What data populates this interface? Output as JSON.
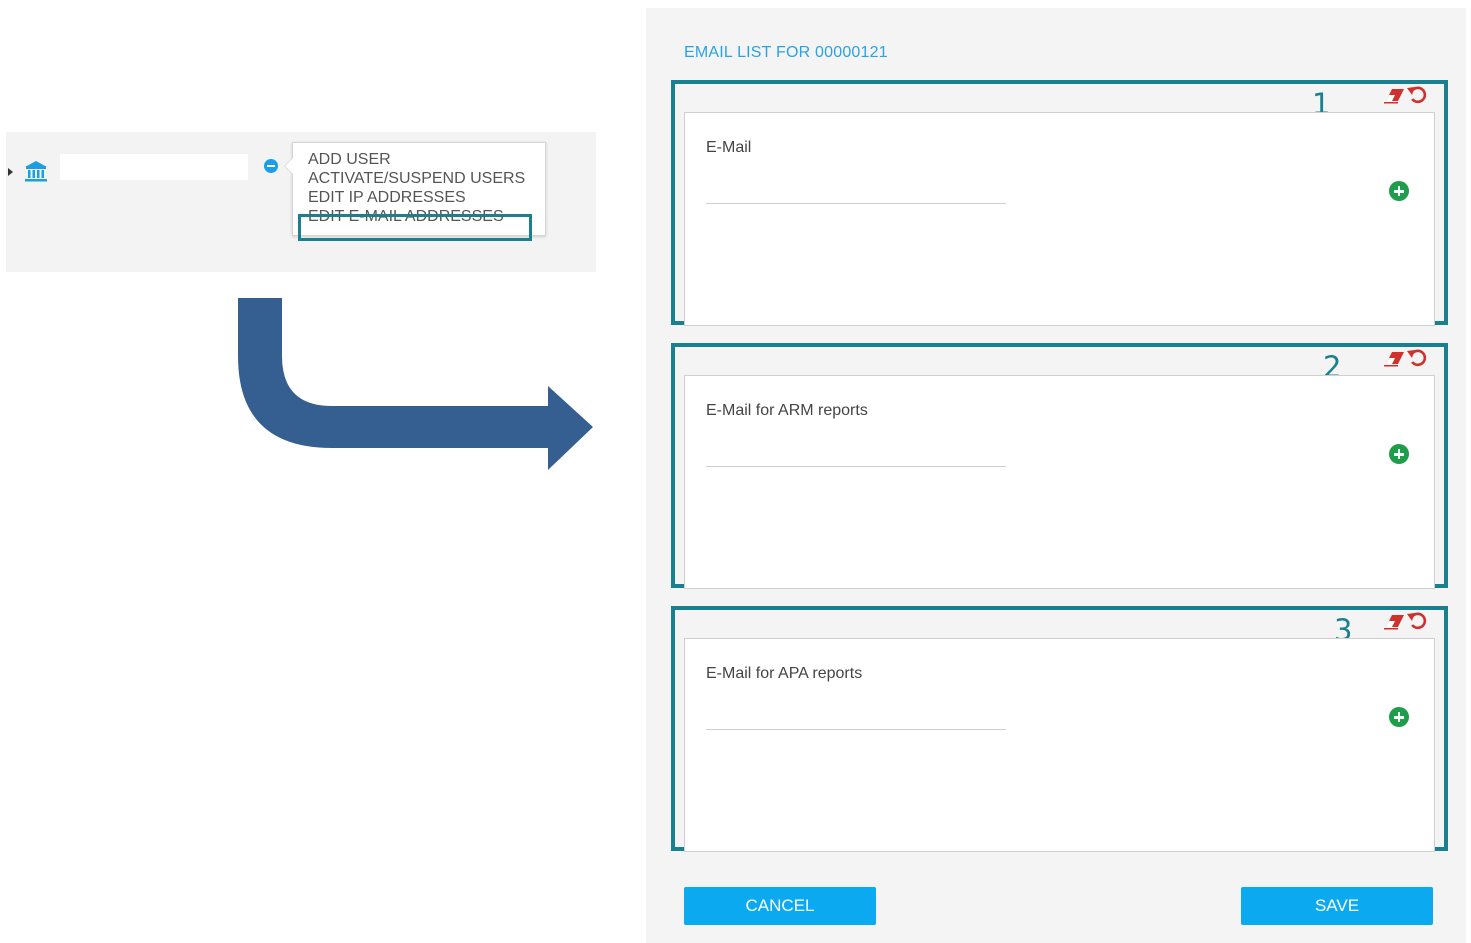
{
  "tree": {
    "node_name": "",
    "context_menu": {
      "items": [
        "ADD USER",
        "ACTIVATE/SUSPEND USERS",
        "EDIT IP ADDRESSES",
        "EDIT E-MAIL ADDRESSES"
      ],
      "highlighted_index": 3
    },
    "icons": {
      "expand": "caret-right-icon",
      "node": "bank-icon",
      "collapse": "minus-circle-icon"
    }
  },
  "dialog": {
    "title": "EMAIL LIST FOR 00000121",
    "sections": [
      {
        "number": "1",
        "label": "E-Mail",
        "value": ""
      },
      {
        "number": "2",
        "label": "E-Mail for ARM reports",
        "value": ""
      },
      {
        "number": "3",
        "label": "E-Mail for APA reports",
        "value": ""
      }
    ],
    "section_icons": [
      "eraser-icon",
      "undo-icon",
      "plus-circle-icon"
    ],
    "cancel_label": "CANCEL",
    "save_label": "SAVE"
  },
  "colors": {
    "annotation": "#1a7f8e",
    "accent": "#0baaf0",
    "title": "#2aa2e6",
    "add": "#1e9e4a",
    "clear": "#d0312d",
    "arrow": "#365f91"
  }
}
